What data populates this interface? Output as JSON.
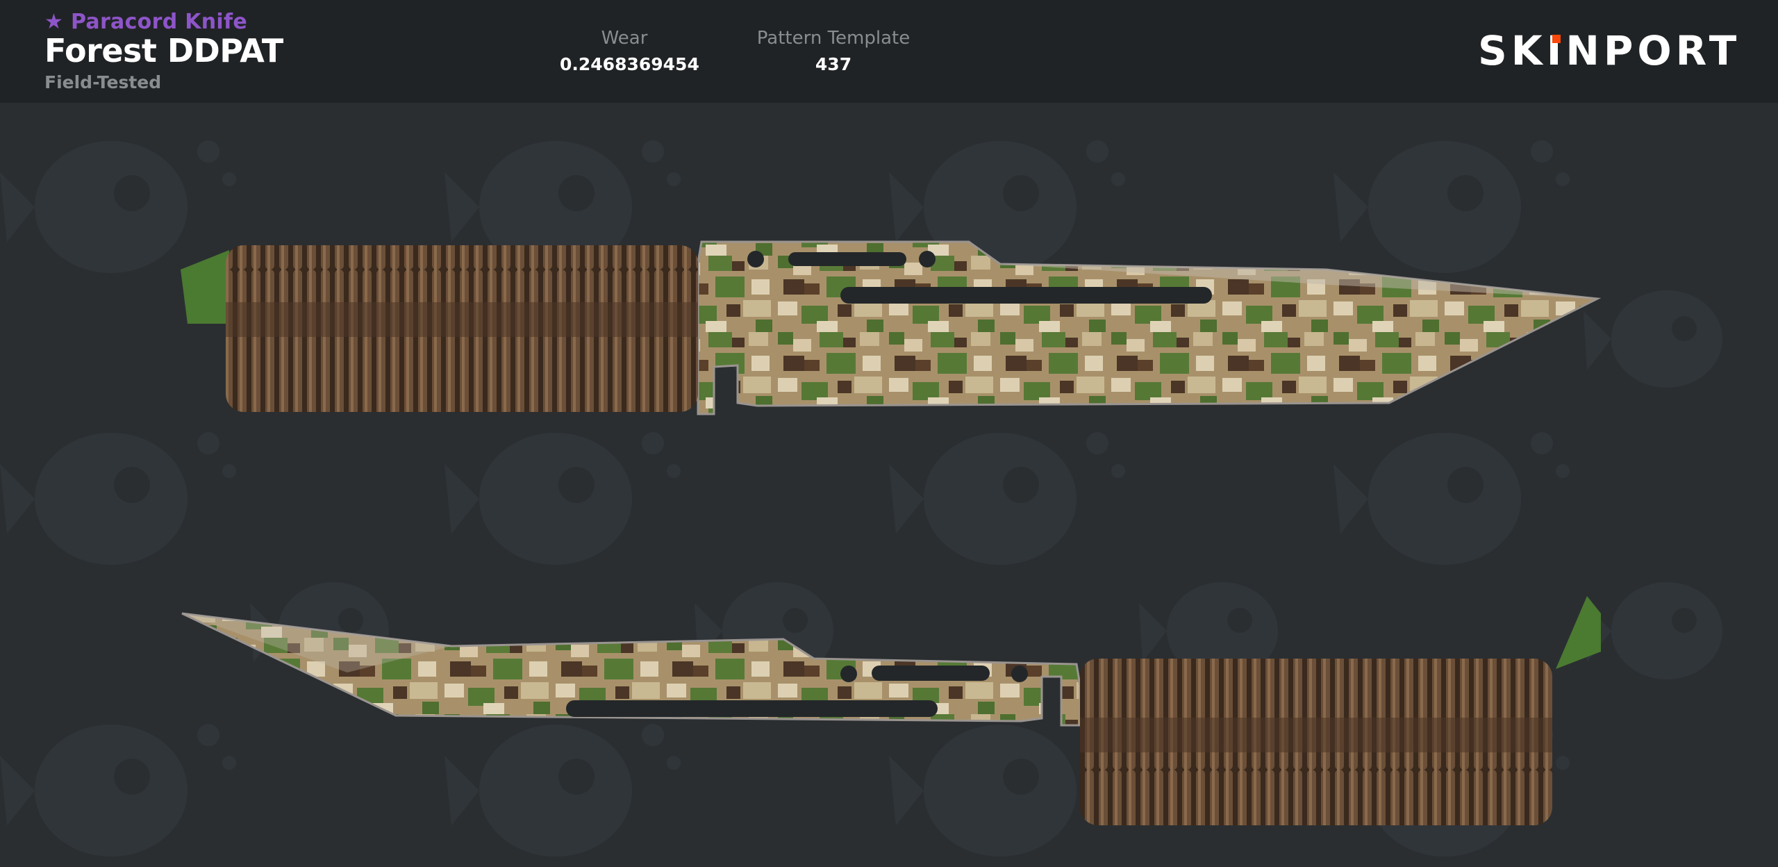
{
  "item": {
    "type_label": "★ Paracord Knife",
    "name": "Forest DDPAT",
    "wear_condition": "Field-Tested"
  },
  "stats": {
    "wear_label": "Wear",
    "wear_value": "0.2468369454",
    "pattern_label": "Pattern Template",
    "pattern_value": "437"
  },
  "brand": {
    "logo_left": "SK",
    "logo_i": "I",
    "logo_right": "NPORT",
    "accent": "#fa490a"
  },
  "colors": {
    "rarity": "#8e55c9",
    "header_bg": "#202325",
    "stage_bg": "#2a2e31"
  },
  "icons": {
    "background_pattern": "fish-skull-icon",
    "knife_views": [
      "knife-front-view",
      "knife-back-view"
    ]
  }
}
